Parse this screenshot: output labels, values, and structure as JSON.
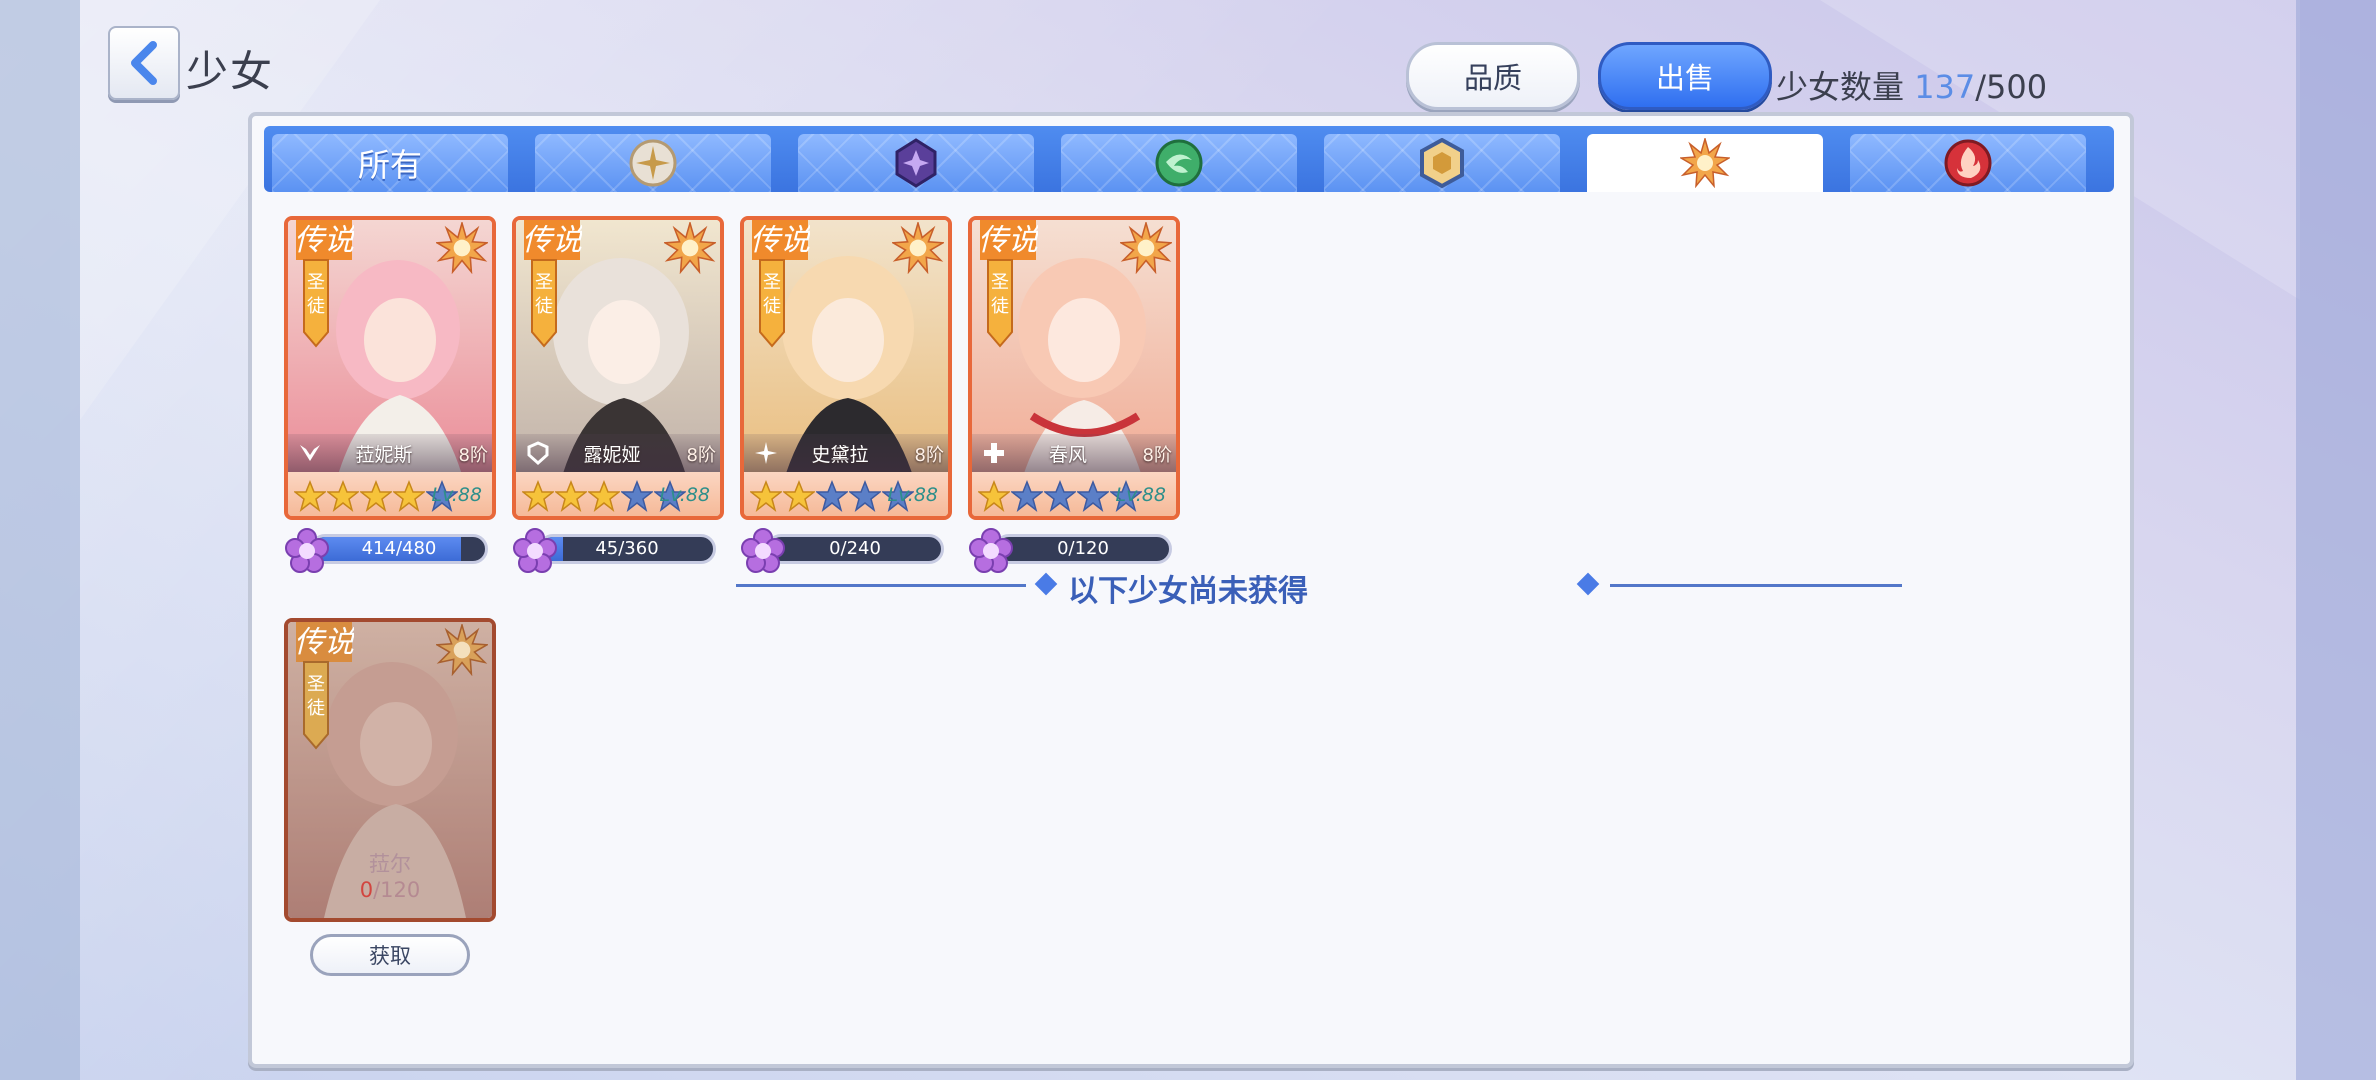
{
  "header": {
    "title": "少女",
    "quality_button": "品质",
    "sell_button": "出售",
    "count_label": "少女数量",
    "count_current": "137",
    "count_sep_max": "/500"
  },
  "tabs": [
    {
      "label": "所有",
      "icon": "all",
      "active": false
    },
    {
      "label": "",
      "icon": "light-element-icon",
      "active": false
    },
    {
      "label": "",
      "icon": "dark-element-icon",
      "active": false
    },
    {
      "label": "",
      "icon": "wind-element-icon",
      "active": false
    },
    {
      "label": "",
      "icon": "earth-element-icon",
      "active": false
    },
    {
      "label": "",
      "icon": "sun-element-icon",
      "active": true
    },
    {
      "label": "",
      "icon": "fire-element-icon",
      "active": false
    }
  ],
  "rarity_label": "传说",
  "faction_label": "圣徒",
  "owned": [
    {
      "name": "菈妮斯",
      "tier": "8阶",
      "stars": 4,
      "level": "Lv.88",
      "shards": "414/480",
      "fraction": 0.86,
      "class_icon": "wing-icon",
      "palette": [
        "#f7b9c4",
        "#e9818f",
        "#f4d6d2"
      ]
    },
    {
      "name": "露妮娅",
      "tier": "8阶",
      "stars": 3,
      "level": "Lv.88",
      "shards": "45/360",
      "fraction": 0.125,
      "class_icon": "shield-icon",
      "palette": [
        "#e9e1da",
        "#b9aaa3",
        "#f1e6cf"
      ]
    },
    {
      "name": "史黛拉",
      "tier": "8阶",
      "stars": 2,
      "level": "Lv.88",
      "shards": "0/240",
      "fraction": 0.0,
      "class_icon": "sparkle-icon",
      "palette": [
        "#f7d9b0",
        "#e8b873",
        "#f2e3cb"
      ]
    },
    {
      "name": "春风",
      "tier": "8阶",
      "stars": 1,
      "level": "Lv.88",
      "shards": "0/120",
      "fraction": 0.0,
      "class_icon": "cross-icon",
      "palette": [
        "#f8c9b4",
        "#f0a48c",
        "#f5dfd2"
      ]
    }
  ],
  "divider_text": "以下少女尚未获得",
  "locked": [
    {
      "name": "菈尔",
      "have": "0",
      "need": "/120",
      "button": "获取",
      "palette": [
        "#d8b3a8",
        "#b98a82",
        "#e5cdbf"
      ]
    }
  ],
  "colors": {
    "accent_blue": "#3b74e0",
    "card_border": "#e8683a",
    "star_filled": "#f6c33a",
    "star_empty": "#5b7fc7"
  }
}
